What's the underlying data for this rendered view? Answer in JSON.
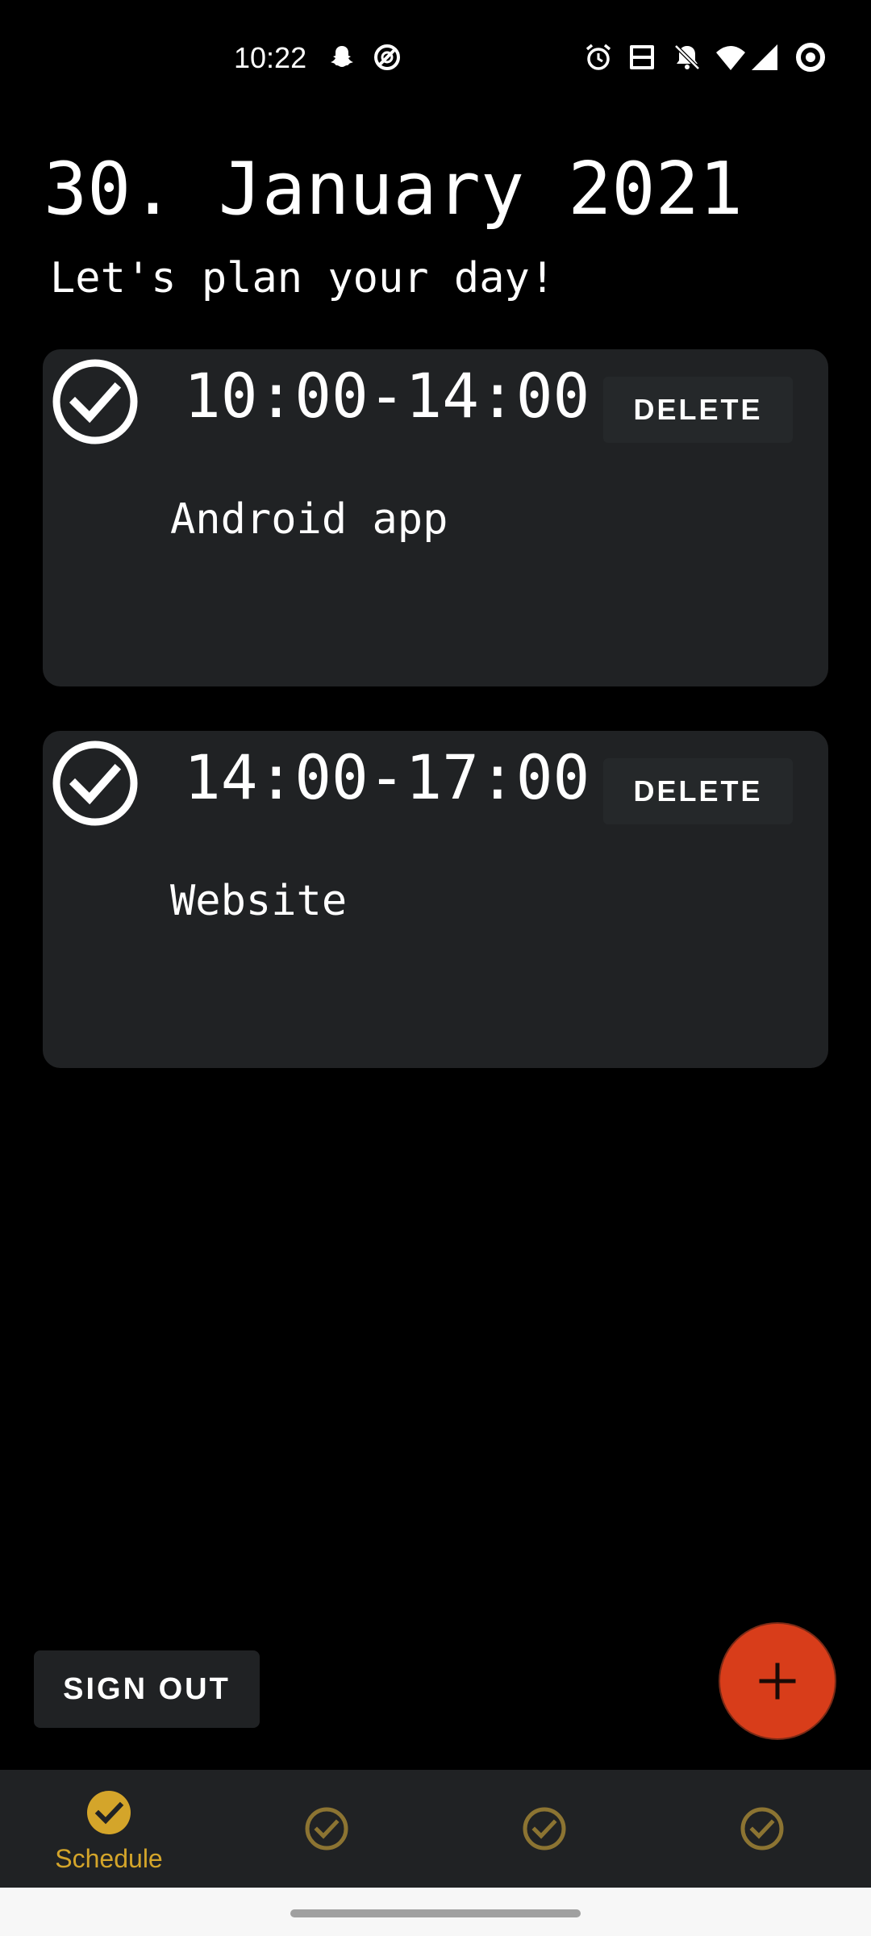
{
  "status_bar": {
    "time": "10:22",
    "left_icons": [
      "snapchat-icon",
      "data-saver-icon"
    ],
    "right_icons": [
      "alarm-icon",
      "volte-icon",
      "notifications-off-icon",
      "wifi-icon",
      "signal-icon",
      "battery-ring-icon"
    ]
  },
  "header": {
    "date": "30. January 2021",
    "subtitle": "Let's plan your day!"
  },
  "tasks": [
    {
      "time": "10:00-14:00",
      "title": "Android app",
      "delete_label": "DELETE",
      "icon": "check-circle-icon"
    },
    {
      "time": "14:00-17:00",
      "title": "Website",
      "delete_label": "DELETE",
      "icon": "check-circle-icon"
    }
  ],
  "sign_out_label": "SIGN OUT",
  "fab": {
    "icon": "plus-icon"
  },
  "bottom_nav": {
    "items": [
      {
        "label": "Schedule",
        "icon": "check-circle-filled-icon",
        "active": true
      },
      {
        "label": "",
        "icon": "check-circle-outline-icon",
        "active": false
      },
      {
        "label": "",
        "icon": "check-circle-outline-icon",
        "active": false
      },
      {
        "label": "",
        "icon": "check-circle-outline-icon",
        "active": false
      }
    ]
  },
  "colors": {
    "background": "#000000",
    "card": "#202224",
    "accent_gold": "#d4a52a",
    "inactive_gold": "#8c7432",
    "fab": "#d83d1a",
    "text": "#ffffff",
    "gesture_bar_bg": "#f7f7f7"
  }
}
